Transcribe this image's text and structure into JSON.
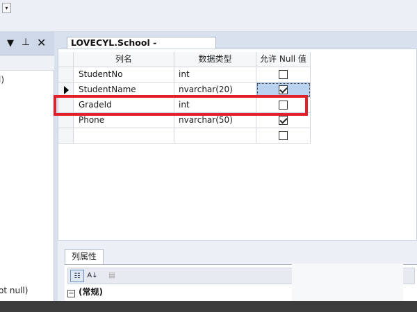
{
  "left_panel": {
    "title_icons": [
      "chevron-down-icon",
      "pin-icon",
      "close-icon"
    ],
    "text_top": "l)",
    "text_bottom": "ot null)"
  },
  "document_tab": {
    "title": "LOVECYL.School - dbo.Student*"
  },
  "grid": {
    "headers": [
      "列名",
      "数据类型",
      "允许 Null 值"
    ],
    "rows": [
      {
        "name": "StudentNo",
        "type": "int",
        "allow_null": false
      },
      {
        "name": "StudentName",
        "type": "nvarchar(20)",
        "allow_null": true
      },
      {
        "name": "GradeId",
        "type": "int",
        "allow_null": false
      },
      {
        "name": "Phone",
        "type": "nvarchar(50)",
        "allow_null": true
      },
      {
        "name": "",
        "type": "",
        "allow_null": false
      }
    ],
    "selected_row_index": 1
  },
  "properties": {
    "tab_label": "列属性",
    "toolbar_icons": [
      "categorized-icon",
      "sort-alpha-icon",
      "property-pages-icon"
    ],
    "section_label": "(常规)"
  },
  "colors": {
    "highlight": "#e0202b",
    "selected_cell": "#b9d3f0"
  }
}
